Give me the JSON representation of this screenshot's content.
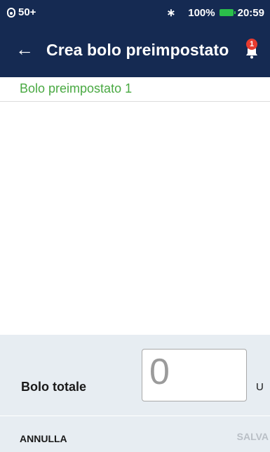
{
  "status_bar": {
    "pod_level": "50+",
    "bluetooth_icon": "bluetooth-icon",
    "battery_percent": "100%",
    "time": "20:59",
    "battery_color": "#2bbf4a"
  },
  "header": {
    "back_icon": "arrow-left-icon",
    "title": "Crea bolo preimpostato",
    "notification_icon": "bell-icon",
    "notification_count": "1",
    "background_color": "#152a52"
  },
  "preset": {
    "name": "Bolo preimpostato 1",
    "name_color": "#49a942"
  },
  "total": {
    "label": "Bolo totale",
    "value": "0",
    "unit": "U"
  },
  "footer": {
    "cancel_label": "ANNULLA",
    "save_label": "SALVA"
  }
}
